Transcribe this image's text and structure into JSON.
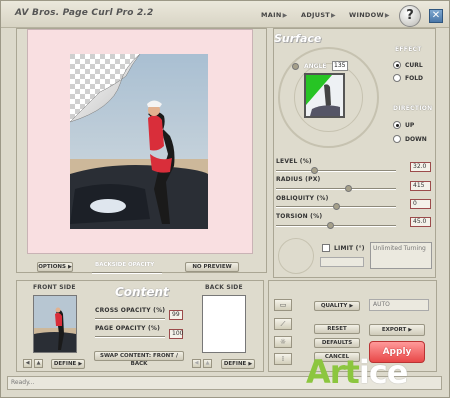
{
  "app": {
    "title": "AV Bros. Page Curl Pro 2.2"
  },
  "menu": {
    "main": "MAIN",
    "adjust": "ADJUST",
    "window": "WINDOW",
    "arrow": "▶"
  },
  "window_controls": {
    "help": "?",
    "close": "✕"
  },
  "preview": {
    "options_button": "OPTIONS",
    "backside_opacity_label": "BACKSIDE OPACITY",
    "no_preview_button": "NO PREVIEW"
  },
  "surface": {
    "title": "Surface",
    "angle_label": "ANGLE",
    "angle_value": "135",
    "effect": {
      "label": "EFFECT",
      "options": [
        "CURL",
        "FOLD"
      ],
      "selected": "CURL"
    },
    "direction": {
      "label": "DIRECTION",
      "options": [
        "UP",
        "DOWN"
      ],
      "selected": "UP"
    },
    "sliders": [
      {
        "label": "LEVEL (%)",
        "value": "32.0",
        "fraction": 0.32
      },
      {
        "label": "RADIUS (PX)",
        "value": "415",
        "fraction": 0.6
      },
      {
        "label": "OBLIQUITY (%)",
        "value": "0",
        "fraction": 0.5
      },
      {
        "label": "TORSION (%)",
        "value": "45.0",
        "fraction": 0.45
      }
    ],
    "limit_label": "LIMIT (°)",
    "limit_value": "Unlimited Turning"
  },
  "content": {
    "title": "Content",
    "front_side_label": "FRONT SIDE",
    "back_side_label": "BACK SIDE",
    "cross_opacity_label": "CROSS OPACITY (%)",
    "cross_opacity_value": "99",
    "page_opacity_label": "PAGE OPACITY (%)",
    "page_opacity_value": "100",
    "swap_button": "SWAP CONTENT: FRONT / BACK",
    "define_front": "DEFINE",
    "define_back": "DEFINE"
  },
  "actions": {
    "quality_button": "QUALITY",
    "quality_value": "AUTO",
    "reset": "RESET",
    "export": "EXPORT",
    "defaults": "DEFAULTS",
    "cancel": "CANCEL",
    "apply": "Apply"
  },
  "status": {
    "text": "Ready..."
  },
  "watermark": {
    "part1": "Art",
    "part2": "ice"
  },
  "colors": {
    "accent_red": "#e84848",
    "canvas_pink": "#f9dfe1",
    "watermark_green": "#8cc63f"
  }
}
